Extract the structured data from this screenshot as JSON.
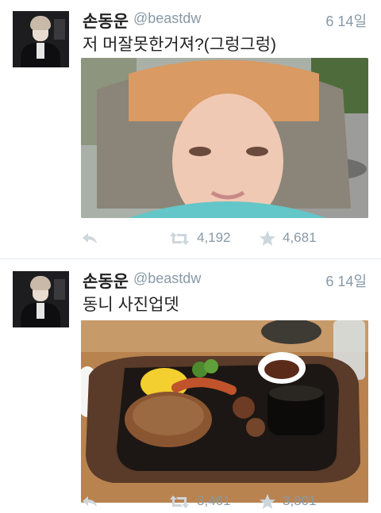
{
  "tweets": [
    {
      "name": "손동운",
      "handle": "@beastdw",
      "date": "6 14일",
      "text": "저 머잘못한거져?(그렁그렁)",
      "retweets": "4,192",
      "favorites": "4,681"
    },
    {
      "name": "손동운",
      "handle": "@beastdw",
      "date": "6 14일",
      "text": "동니 사진업뎃",
      "retweets": "3,461",
      "favorites": "3,801"
    }
  ],
  "colors": {
    "meta": "#8899a6",
    "icon": "#ccd6dd",
    "divider": "#e1e8ed"
  },
  "icons": [
    "reply-icon",
    "retweet-icon",
    "favorite-star-icon"
  ]
}
